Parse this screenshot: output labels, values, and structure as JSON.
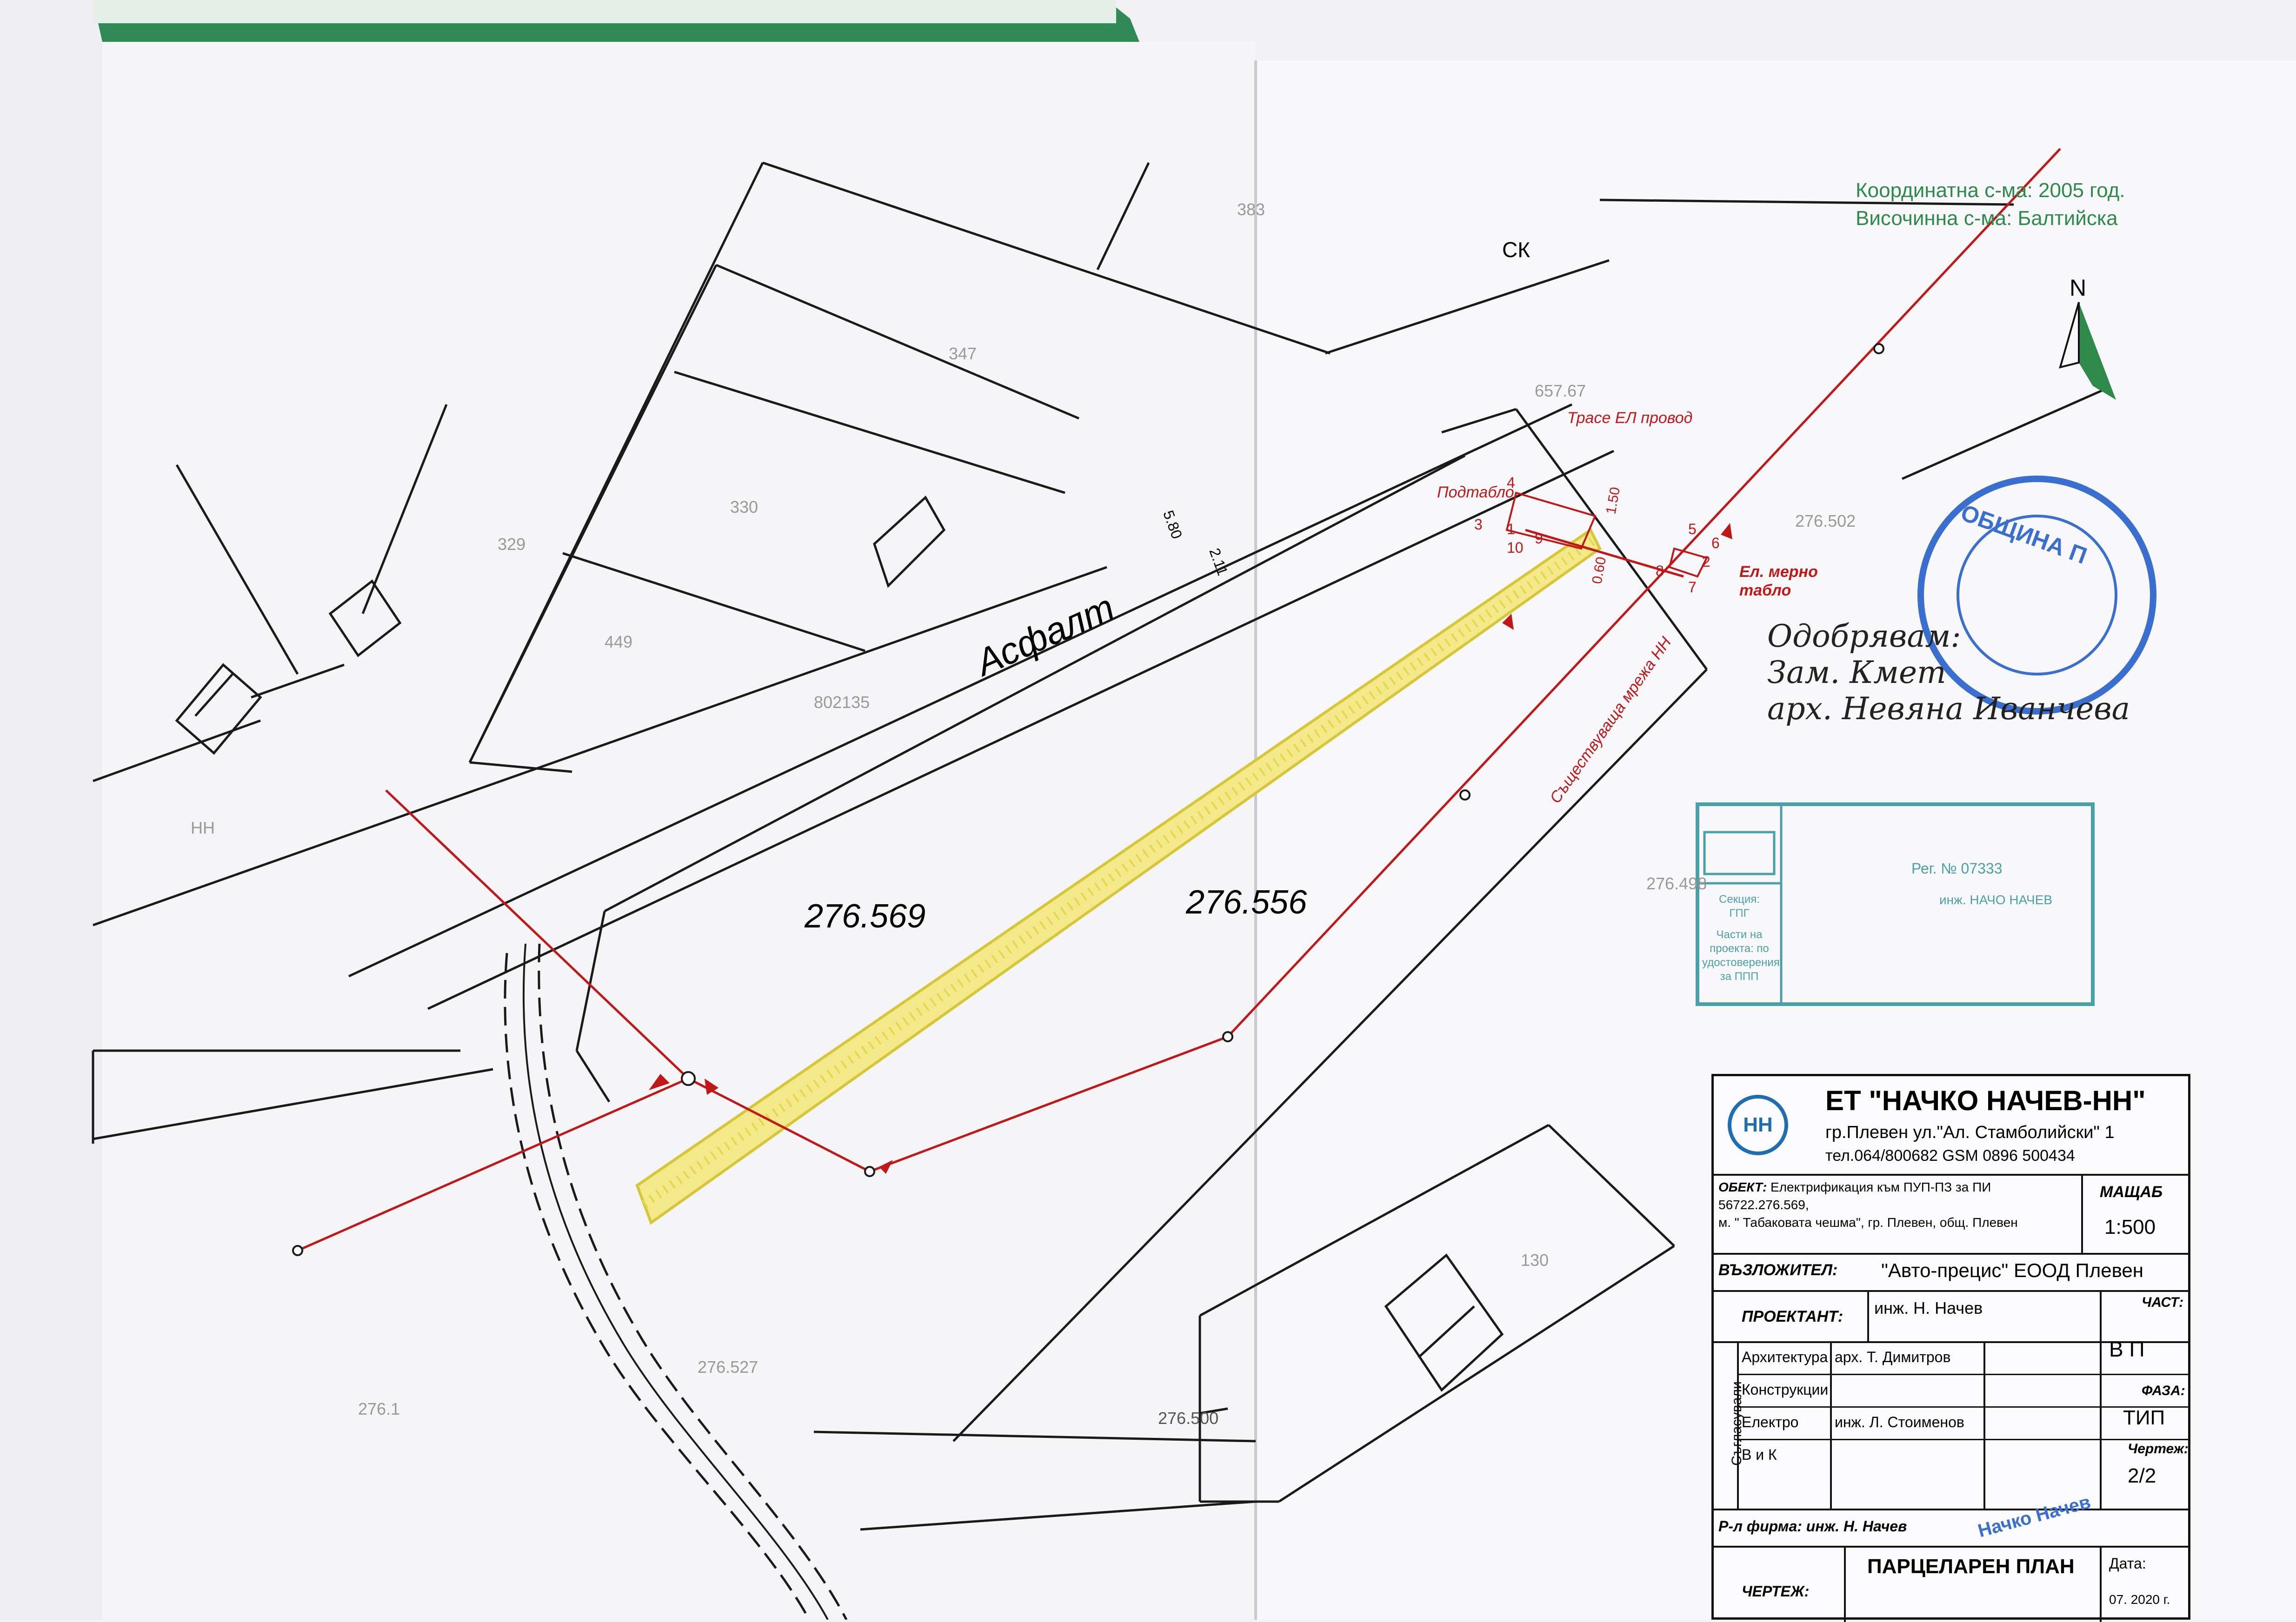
{
  "map": {
    "coord_note_line1": "Координатна с-ма: 2005 год.",
    "coord_note_line2": "Височинна с-ма: Балтийска",
    "north_label": "N",
    "street_label": "Асфалт",
    "parcels": {
      "p383": "383",
      "p347": "347",
      "p330": "330",
      "p329": "329",
      "p449": "449",
      "p802135": "802135",
      "p130": "130",
      "p276_1": "276.1",
      "p276_527": "276.527",
      "p276_500": "276.500",
      "p276_502": "276.502",
      "p276_498": "276.498",
      "p657_67": "657.67",
      "pHH": "НН"
    },
    "big_labels": {
      "left": "276.569",
      "right": "276.556"
    },
    "ck_label": "СК",
    "dims": {
      "d580": "5.80",
      "d211": "2.11",
      "d150": "1.50",
      "d060": "0.60"
    },
    "red_labels": {
      "trace": "Трасе ЕЛ провод",
      "podtablo": "Подтабло",
      "el_tablo_line1": "Ел. мерно",
      "el_tablo_line2": "табло",
      "existing_net": "Съществуваща мрежа НН"
    },
    "point_numbers": [
      "1",
      "2",
      "3",
      "4",
      "5",
      "6",
      "7",
      "8",
      "9",
      "10"
    ]
  },
  "approval": {
    "line1": "Одобрявам:",
    "line2": "Зам. Кмет",
    "line3": "арх. Невяна Иванчева"
  },
  "stamps": {
    "municipality_text": "ОБЩИНА П",
    "kiip_section": "Секция:",
    "kiip_section_value": "ГПГ",
    "kiip_parts": "Части на проекта: по удостоверения за ППП",
    "kiip_reg": "Рег. № 07333",
    "kiip_name": "инж. НАЧО НАЧЕВ",
    "firm_stamp": "Начко Начев"
  },
  "titleblock": {
    "company": "ЕТ \"НАЧКО НАЧЕВ-НН\"",
    "logo_text": "НН",
    "address": "гр.Плевен ул.\"Ал. Стамболийски\" 1",
    "phone": "тел.064/800682 GSM 0896 500434",
    "object_label": "ОБЕКТ:",
    "object_text_line1": "Електрификация към ПУП-ПЗ за ПИ 56722.276.569,",
    "object_text_line2": "м. \" Табаковата чешма\", гр. Плевен, общ. Плевен",
    "scale_label": "МАЩАБ",
    "scale_value": "1:500",
    "client_label": "ВЪЗЛОЖИТЕЛ:",
    "client_value": "\"Авто-прецис\" ЕООД Плевен",
    "designer_label": "ПРОЕКТАНТ:",
    "designer_value": "инж. Н. Начев",
    "part_label": "ЧАСТ:",
    "part_value": "В П",
    "agreed_label": "Съгласували",
    "agreements": [
      {
        "name": "Архитектура",
        "person": "арх. Т. Димитров"
      },
      {
        "name": "Конструкции",
        "person": ""
      },
      {
        "name": "Електро",
        "person": "инж. Л. Стоименов"
      },
      {
        "name": "В и К",
        "person": ""
      }
    ],
    "phase_label": "ФАЗА:",
    "phase_value": "ТИП",
    "sheet_label": "Чертеж:",
    "sheet_value": "2/2",
    "manager_label": "Р-л фирма:",
    "manager_value": "инж. Н. Начев",
    "drawing_label": "ЧЕРТЕЖ:",
    "drawing_value": "ПАРЦЕЛАРЕН ПЛАН",
    "date_label": "Дата:",
    "date_value": "07. 2020 г."
  },
  "colors": {
    "line": "#1a1a1a",
    "red": "#c01818",
    "green": "#2e8a4a",
    "yellow": "#e5d84a",
    "stamp_blue": "#3a6fd0",
    "stamp_teal": "#4aa0a8"
  }
}
